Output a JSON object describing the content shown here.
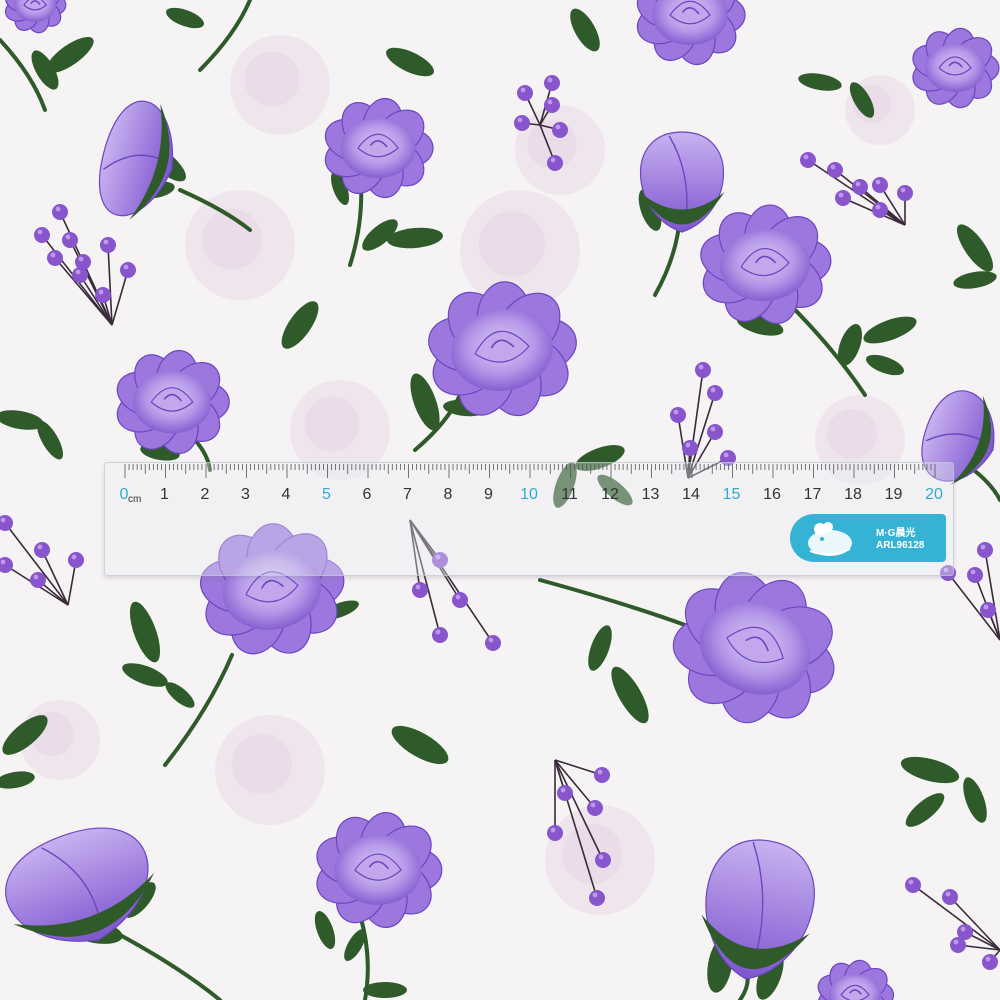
{
  "scene": {
    "description_tags": [
      "floral-fabric",
      "ruler"
    ],
    "colors": {
      "background": "#f6f3f4",
      "rose_light": "#c2a7ec",
      "rose_mid": "#9b77de",
      "rose_dark": "#6c46c0",
      "berry": "#8855cc",
      "leaf": "#2f5a2a",
      "leaf_light": "#3e7035",
      "faint_rose": "#ece0ea",
      "ruler_accent": "#36b3d4"
    }
  },
  "ruler": {
    "unit": "cm",
    "labels": [
      "0",
      "1",
      "2",
      "3",
      "4",
      "5",
      "6",
      "7",
      "8",
      "9",
      "10",
      "11",
      "12",
      "13",
      "14",
      "15",
      "16",
      "17",
      "18",
      "19",
      "20"
    ],
    "blue_labels": [
      "0",
      "5",
      "10",
      "15",
      "20"
    ],
    "brand": "M·G晨光",
    "model": "ARL96128"
  }
}
